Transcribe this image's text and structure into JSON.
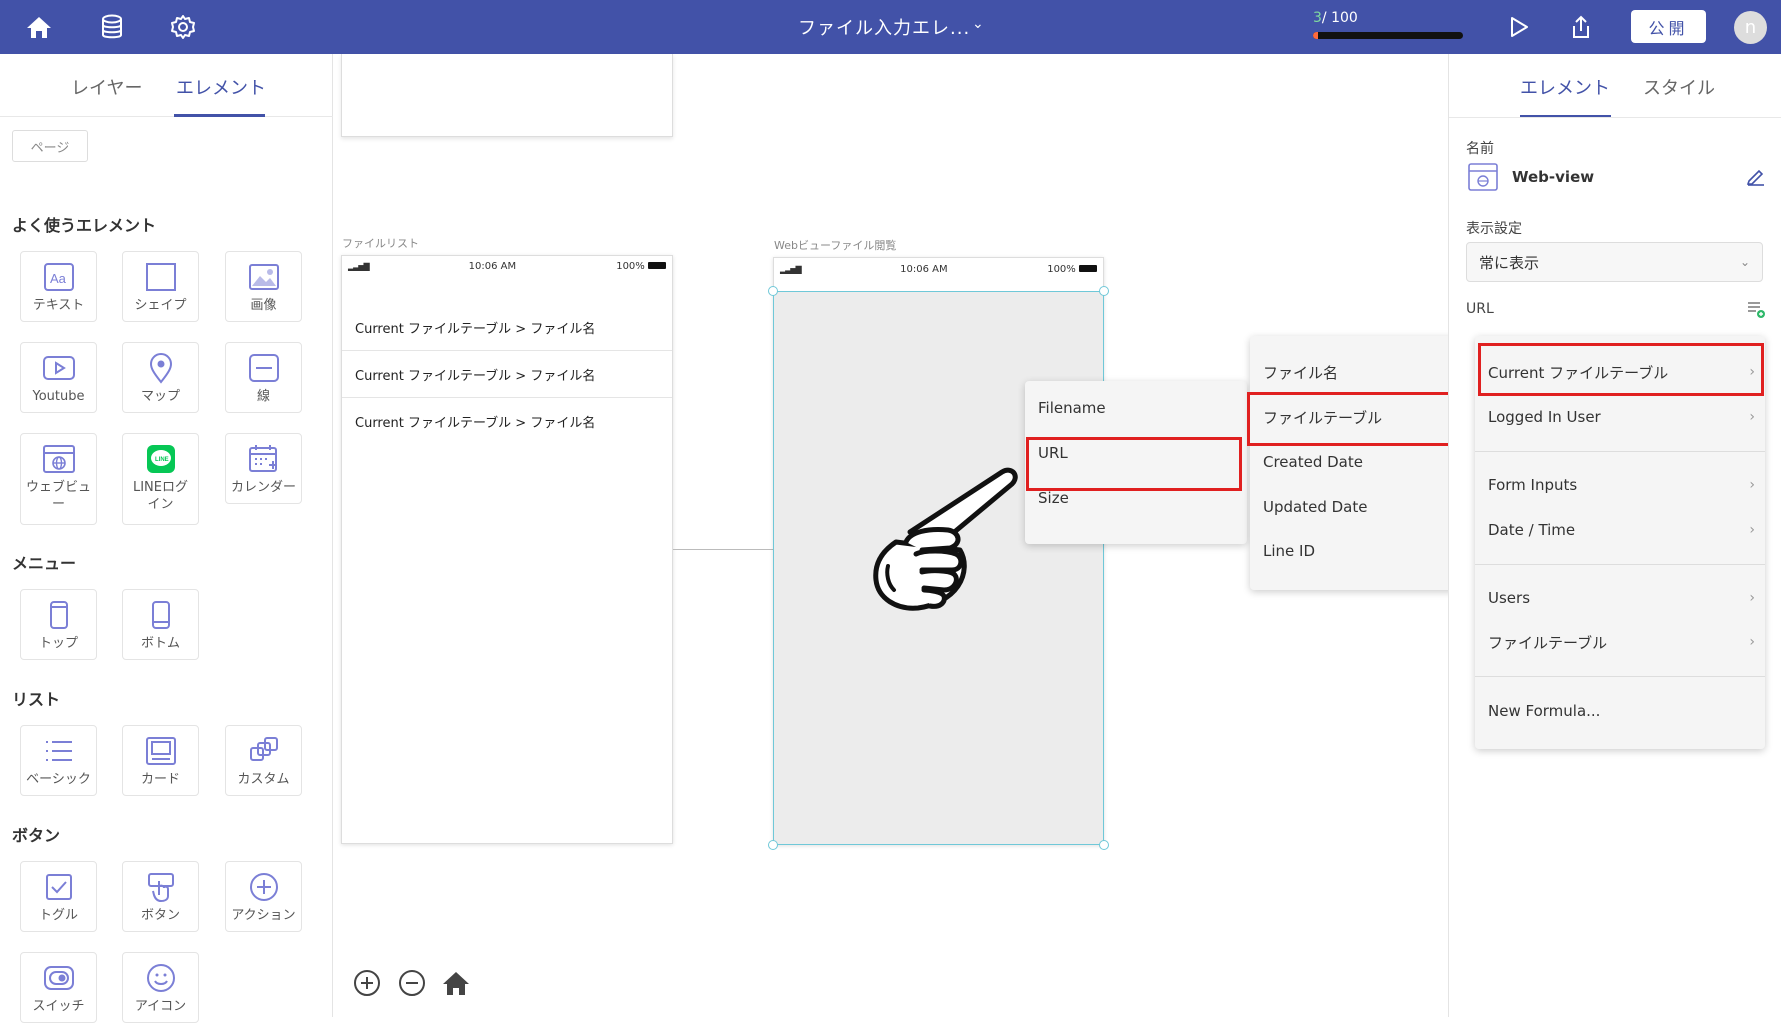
{
  "header": {
    "app_title": "ファイル入力エレ...",
    "title_caret": "⌄",
    "progress_current": "3",
    "progress_total": "/ 100",
    "progress_fraction": 0.03,
    "publish_label": "公開",
    "avatar_initial": "n"
  },
  "left_panel": {
    "tabs": [
      "レイヤー",
      "エレメント"
    ],
    "page_chip": "ページ",
    "sections": {
      "common": "よく使うエレメント",
      "menu": "メニュー",
      "list": "リスト",
      "button": "ボタン"
    },
    "elements": {
      "text": "テキスト",
      "shape": "シェイプ",
      "image": "画像",
      "youtube": "Youtube",
      "map": "マップ",
      "line": "線",
      "webview": "ウェブビュー",
      "line_login": "LINEログイン",
      "calendar": "カレンダー",
      "top": "トップ",
      "bottom": "ボトム",
      "basic": "ベーシック",
      "card": "カード",
      "custom": "カスタム",
      "toggle": "トグル",
      "button": "ボタン",
      "action": "アクション",
      "switch": "スイッチ",
      "icon": "アイコン"
    }
  },
  "canvas": {
    "screen1_label": "ファイルリスト",
    "screen2_label": "Webビューファイル閲覧",
    "status_time": "10:06 AM",
    "status_battery": "100%",
    "list_rows": [
      "Current ファイルテーブル > ファイル名",
      "Current ファイルテーブル > ファイル名",
      "Current ファイルテーブル > ファイル名"
    ]
  },
  "menus": {
    "menu1": [
      "Filename",
      "URL",
      "Size"
    ],
    "menu2": [
      "ファイル名",
      "ファイルテーブル",
      "Created Date",
      "Updated Date",
      "Line ID"
    ],
    "menu3": {
      "group1": [
        "Current ファイルテーブル",
        "Logged In User"
      ],
      "group2": [
        "Form Inputs",
        "Date / Time"
      ],
      "group3": [
        "Users",
        "ファイルテーブル"
      ],
      "group4": [
        "New Formula..."
      ]
    }
  },
  "right_panel": {
    "tabs": [
      "エレメント",
      "スタイル"
    ],
    "name_label": "名前",
    "name_value": "Web-view",
    "display_label": "表示設定",
    "display_value": "常に表示",
    "url_label": "URL"
  },
  "colors": {
    "brand": "#4252a8",
    "highlight": "#e02020",
    "selection": "#6fc8d8"
  }
}
